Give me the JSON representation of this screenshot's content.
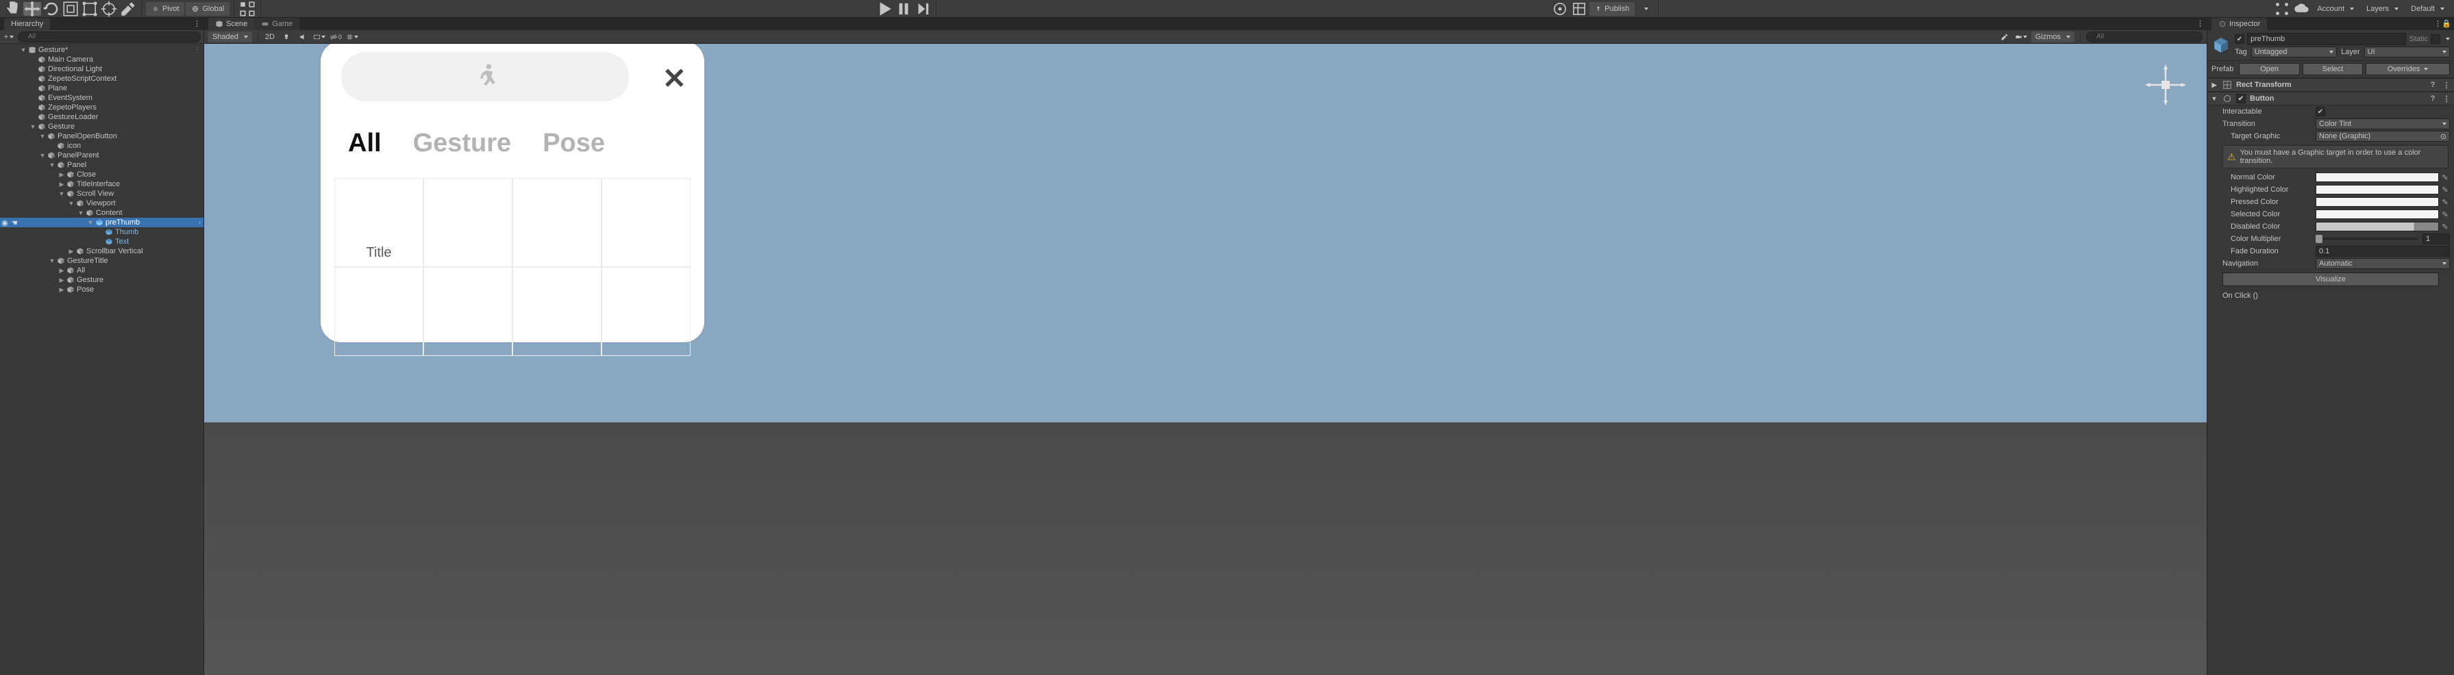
{
  "toolbar": {
    "pivot": "Pivot",
    "global": "Global",
    "publish": "Publish",
    "account": "Account",
    "layers": "Layers",
    "layout": "Default"
  },
  "hierarchy": {
    "title": "Hierarchy",
    "search_placeholder": "All",
    "scene": "Gesture*",
    "items": [
      {
        "depth": 1,
        "fold": "",
        "label": "Main Camera"
      },
      {
        "depth": 1,
        "fold": "",
        "label": "Directional Light"
      },
      {
        "depth": 1,
        "fold": "",
        "label": "ZepetoScriptContext"
      },
      {
        "depth": 1,
        "fold": "",
        "label": "Plane"
      },
      {
        "depth": 1,
        "fold": "",
        "label": "EventSystem"
      },
      {
        "depth": 1,
        "fold": "",
        "label": "ZepetoPlayers"
      },
      {
        "depth": 1,
        "fold": "",
        "label": "GestureLoader"
      },
      {
        "depth": 1,
        "fold": "open",
        "label": "Gesture"
      },
      {
        "depth": 2,
        "fold": "open",
        "label": "PanelOpenButton"
      },
      {
        "depth": 3,
        "fold": "",
        "label": "icon"
      },
      {
        "depth": 2,
        "fold": "open",
        "label": "PanelParent"
      },
      {
        "depth": 3,
        "fold": "open",
        "label": "Panel"
      },
      {
        "depth": 4,
        "fold": "closed",
        "label": "Close"
      },
      {
        "depth": 4,
        "fold": "closed",
        "label": "TitleInterface"
      },
      {
        "depth": 4,
        "fold": "open",
        "label": "Scroll View"
      },
      {
        "depth": 5,
        "fold": "open",
        "label": "Viewport"
      },
      {
        "depth": 6,
        "fold": "open",
        "label": "Content"
      },
      {
        "depth": 7,
        "fold": "open",
        "label": "preThumb",
        "selected": true,
        "chev": true
      },
      {
        "depth": 8,
        "fold": "",
        "label": "Thumb",
        "blue": true
      },
      {
        "depth": 8,
        "fold": "",
        "label": "Text",
        "blue": true
      },
      {
        "depth": 5,
        "fold": "closed",
        "label": "Scrollbar Vertical"
      },
      {
        "depth": 3,
        "fold": "open",
        "label": "GestureTitle"
      },
      {
        "depth": 4,
        "fold": "closed",
        "label": "All"
      },
      {
        "depth": 4,
        "fold": "closed",
        "label": "Gesture"
      },
      {
        "depth": 4,
        "fold": "closed",
        "label": "Pose"
      }
    ]
  },
  "center": {
    "tabs": {
      "scene": "Scene",
      "game": "Game"
    },
    "shading": "Shaded",
    "mode2d": "2D",
    "gizmos": "Gizmos",
    "zero": "0",
    "search_placeholder": "All"
  },
  "ui_panel": {
    "tabs": [
      "All",
      "Gesture",
      "Pose"
    ],
    "cell_label": "Title"
  },
  "inspector": {
    "title": "Inspector",
    "name": "preThumb",
    "static": "Static",
    "tag_label": "Tag",
    "tag_value": "Untagged",
    "layer_label": "Layer",
    "layer_value": "UI",
    "prefab_label": "Prefab",
    "prefab_open": "Open",
    "prefab_select": "Select",
    "prefab_overrides": "Overrides",
    "rect_transform": "Rect Transform",
    "button_comp": "Button",
    "interactable": "Interactable",
    "transition": "Transition",
    "transition_value": "Color Tint",
    "target_graphic": "Target Graphic",
    "target_graphic_value": "None (Graphic)",
    "warn": "You must have a Graphic target in order to use a color transition.",
    "normal_color": "Normal Color",
    "highlighted_color": "Highlighted Color",
    "pressed_color": "Pressed Color",
    "selected_color": "Selected Color",
    "disabled_color": "Disabled Color",
    "color_multiplier": "Color Multiplier",
    "color_multiplier_value": "1",
    "fade_duration": "Fade Duration",
    "fade_duration_value": "0.1",
    "navigation": "Navigation",
    "navigation_value": "Automatic",
    "visualize": "Visualize",
    "on_click": "On Click ()"
  }
}
